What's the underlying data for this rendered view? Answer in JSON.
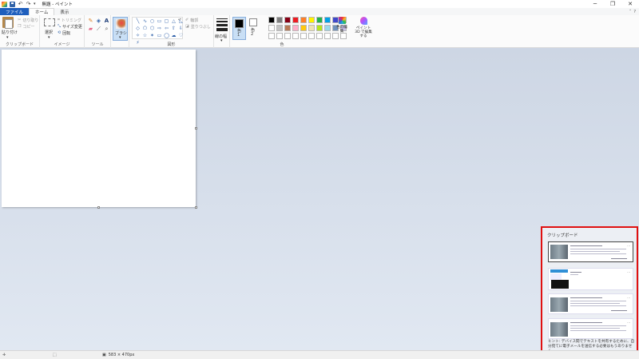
{
  "window": {
    "title": "無題 - ペイント",
    "controls": {
      "minimize": "─",
      "maximize": "❐",
      "close": "✕"
    }
  },
  "quick_access": {
    "undo": "↶",
    "redo": "↷",
    "dropdown": "▾"
  },
  "tabs": [
    {
      "label": "ファイル",
      "active": false
    },
    {
      "label": "ホーム",
      "active": true
    },
    {
      "label": "表示",
      "active": false
    }
  ],
  "tab_right": {
    "collapse": "˄",
    "help": "?"
  },
  "ribbon": {
    "clipboard": {
      "paste": "貼り付け",
      "cut": "切り取り",
      "copy": "コピー",
      "label": "クリップボード"
    },
    "image": {
      "select": "選択",
      "crop": "トリミング",
      "resize": "サイズ変更",
      "rotate": "回転",
      "label": "イメージ"
    },
    "tools": {
      "label": "ツール"
    },
    "brushes": {
      "label": "ブラシ"
    },
    "shapes": {
      "outline": "輪郭",
      "fill": "塗りつぶし",
      "label": "図形",
      "glyphs": [
        "╲",
        "∿",
        "○",
        "▭",
        "▢",
        "△",
        "◺",
        "◇",
        "⬠",
        "⬡",
        "⇨",
        "⇦",
        "⇧",
        "⇩",
        "✧",
        "☆",
        "✶",
        "▭",
        "◯",
        "☁",
        "♡",
        "⚡"
      ]
    },
    "size": {
      "label": "線の幅"
    },
    "colors": {
      "color1": "色\n1",
      "color2": "色\n2",
      "edit": "色の編集",
      "paint3d": "ペイント 3D で編集する",
      "label": "色",
      "color1_value": "#000000",
      "color2_value": "#ffffff",
      "swatches": [
        "#000000",
        "#7f7f7f",
        "#880015",
        "#ed1c24",
        "#ff7f27",
        "#fff200",
        "#22b14c",
        "#00a2e8",
        "#3f48cc",
        "#a349a4",
        "#ffffff",
        "#c3c3c3",
        "#b97a57",
        "#ffaec9",
        "#ffc90e",
        "#efe4b0",
        "#b5e61d",
        "#99d9ea",
        "#7092be",
        "#c8bfe7",
        "#ffffff",
        "#ffffff",
        "#ffffff",
        "#ffffff",
        "#ffffff",
        "#ffffff",
        "#ffffff",
        "#ffffff",
        "#ffffff",
        "#ffffff"
      ]
    }
  },
  "clipboard_panel": {
    "title": "クリップボード",
    "more": "···",
    "message": "ヒント: デバイス間でテキストを共有するために、自分宛てに電子メールを送信する必要はもうありません。",
    "link": "もっと良い方法があります。"
  },
  "statusbar": {
    "canvas_size": "583 × 470px"
  }
}
